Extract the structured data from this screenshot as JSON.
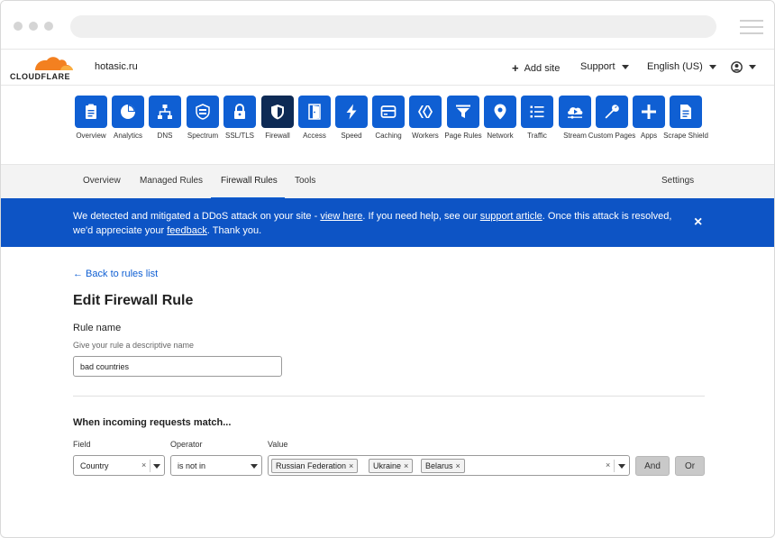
{
  "header": {
    "brand": "CLOUDFLARE",
    "domain": "hotasic.ru",
    "add_site": "Add site",
    "support": "Support",
    "language": "English (US)",
    "brand_color": "#f38020"
  },
  "nav": [
    {
      "label": "Overview",
      "icon": "clipboard-icon"
    },
    {
      "label": "Analytics",
      "icon": "pie-chart-icon"
    },
    {
      "label": "DNS",
      "icon": "network-tree-icon"
    },
    {
      "label": "Spectrum",
      "icon": "shield-server-icon"
    },
    {
      "label": "SSL/TLS",
      "icon": "lock-icon"
    },
    {
      "label": "Firewall",
      "icon": "firewall-shield-icon"
    },
    {
      "label": "Access",
      "icon": "door-icon"
    },
    {
      "label": "Speed",
      "icon": "lightning-icon"
    },
    {
      "label": "Caching",
      "icon": "server-card-icon"
    },
    {
      "label": "Workers",
      "icon": "workers-icon"
    },
    {
      "label": "Page Rules",
      "icon": "filter-icon"
    },
    {
      "label": "Network",
      "icon": "location-pin-icon"
    },
    {
      "label": "Traffic",
      "icon": "list-icon"
    },
    {
      "label": "Stream",
      "icon": "cloud-play-icon"
    },
    {
      "label": "Custom Pages",
      "icon": "wrench-icon"
    },
    {
      "label": "Apps",
      "icon": "plus-icon"
    },
    {
      "label": "Scrape Shield",
      "icon": "document-icon"
    }
  ],
  "subtabs": {
    "overview": "Overview",
    "managed_rules": "Managed Rules",
    "firewall_rules": "Firewall Rules",
    "tools": "Tools",
    "settings": "Settings"
  },
  "banner": {
    "part1": "We detected and mitigated a DDoS attack on your site - ",
    "link1": "view here",
    "part2": ". If you need help, see our ",
    "link2": "support article",
    "part3": ". Once this attack is resolved, we'd appreciate your ",
    "link3": "feedback",
    "part4": ". Thank you.",
    "close": "×",
    "color": "#0d54c5"
  },
  "main": {
    "back_link": "← Back to rules list",
    "title": "Edit Firewall Rule",
    "rule_name_label": "Rule name",
    "rule_name_hint": "Give your rule a descriptive name",
    "rule_name_value": "bad countries",
    "match_title": "When incoming requests match...",
    "field_label": "Field",
    "operator_label": "Operator",
    "value_label": "Value",
    "field_value": "Country",
    "operator_value": "is not in",
    "values": [
      "Russian Federation",
      "Ukraine",
      "Belarus"
    ],
    "clear": "×",
    "and_button": "And",
    "or_button": "Or"
  }
}
